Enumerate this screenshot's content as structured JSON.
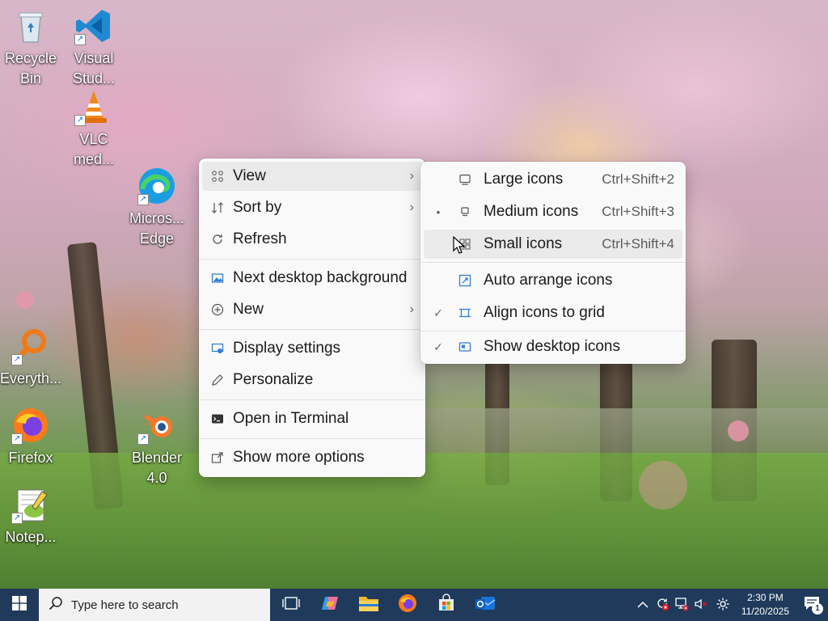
{
  "desktop": {
    "icons": [
      {
        "label": "Recycle\nBin"
      },
      {
        "label": "Visual\nStud..."
      },
      {
        "label": "VLC\nmed..."
      },
      {
        "label": "Micros...\nEdge"
      },
      {
        "label": "Everyth..."
      },
      {
        "label": "Firefox"
      },
      {
        "label": "Blender\n4.0"
      },
      {
        "label": "Notep..."
      }
    ]
  },
  "context_menu": {
    "items": [
      {
        "label": "View",
        "icon": "grid-icon",
        "has_submenu": true
      },
      {
        "label": "Sort by",
        "icon": "sort-icon",
        "has_submenu": true
      },
      {
        "label": "Refresh",
        "icon": "refresh-icon"
      },
      {
        "label": "Next desktop background",
        "icon": "background-icon"
      },
      {
        "label": "New",
        "icon": "plus-circle-icon",
        "has_submenu": true
      },
      {
        "label": "Display settings",
        "icon": "display-icon"
      },
      {
        "label": "Personalize",
        "icon": "pen-icon"
      },
      {
        "label": "Open in Terminal",
        "icon": "terminal-icon"
      },
      {
        "label": "Show more options",
        "icon": "share-icon"
      }
    ]
  },
  "view_submenu": {
    "items": [
      {
        "label": "Large icons",
        "shortcut": "Ctrl+Shift+2",
        "mark": ""
      },
      {
        "label": "Medium icons",
        "shortcut": "Ctrl+Shift+3",
        "mark": "•"
      },
      {
        "label": "Small icons",
        "shortcut": "Ctrl+Shift+4",
        "mark": ""
      },
      {
        "label": "Auto arrange icons",
        "shortcut": "",
        "mark": ""
      },
      {
        "label": "Align icons to grid",
        "shortcut": "",
        "mark": "✓"
      },
      {
        "label": "Show desktop icons",
        "shortcut": "",
        "mark": "✓"
      }
    ]
  },
  "taskbar": {
    "search_placeholder": "Type here to search",
    "time": "2:30 PM",
    "date": "11/20/2025",
    "notification_count": "1"
  },
  "colors": {
    "taskbar": "#1f3a5b",
    "menu_bg": "#f9f9f9",
    "menu_highlight": "#eaeaea"
  }
}
